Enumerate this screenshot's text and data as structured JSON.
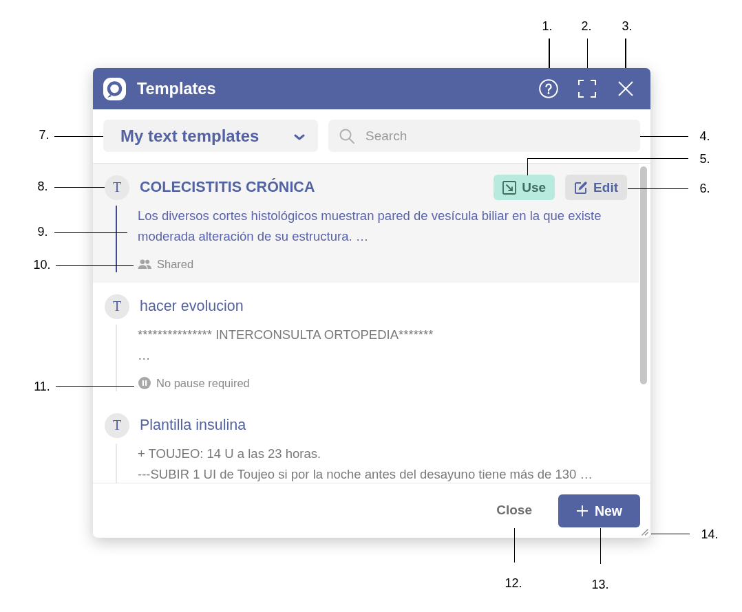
{
  "dialog": {
    "title": "Templates",
    "template_selector": {
      "value": "My text templates"
    },
    "search": {
      "placeholder": "Search"
    },
    "templates": [
      {
        "avatar": "T",
        "title": "COLECISTITIS CRÓNICA",
        "selected": true,
        "actions": [
          {
            "kind": "use",
            "label": "Use"
          },
          {
            "kind": "edit",
            "label": "Edit"
          }
        ],
        "preview": [
          "Los diversos cortes histológicos muestran pared de vesícula biliar en la que existe moderada alteración de su estructura. …"
        ],
        "status": {
          "kind": "shared",
          "label": "Shared"
        }
      },
      {
        "avatar": "T",
        "title": "hacer evolucion",
        "selected": false,
        "preview": [
          "*************** INTERCONSULTA ORTOPEDIA*******",
          "…"
        ],
        "status": {
          "kind": "no_pause",
          "label": "No pause required"
        }
      },
      {
        "avatar": "T",
        "title": "Plantilla insulina",
        "selected": false,
        "preview": [
          "+ TOUJEO: 14 U a las 23 horas.",
          "---SUBIR 1 UI de Toujeo si por la noche antes del desayuno tiene más de 130 …"
        ]
      }
    ],
    "footer": {
      "close_button": "Close",
      "new_button": "New"
    }
  },
  "callouts": [
    {
      "label": "1."
    },
    {
      "label": "2."
    },
    {
      "label": "3."
    },
    {
      "label": "4."
    },
    {
      "label": "5."
    },
    {
      "label": "6."
    },
    {
      "label": "7."
    },
    {
      "label": "8."
    },
    {
      "label": "9."
    },
    {
      "label": "10."
    },
    {
      "label": "11."
    },
    {
      "label": "12."
    },
    {
      "label": "13."
    },
    {
      "label": "14."
    }
  ]
}
